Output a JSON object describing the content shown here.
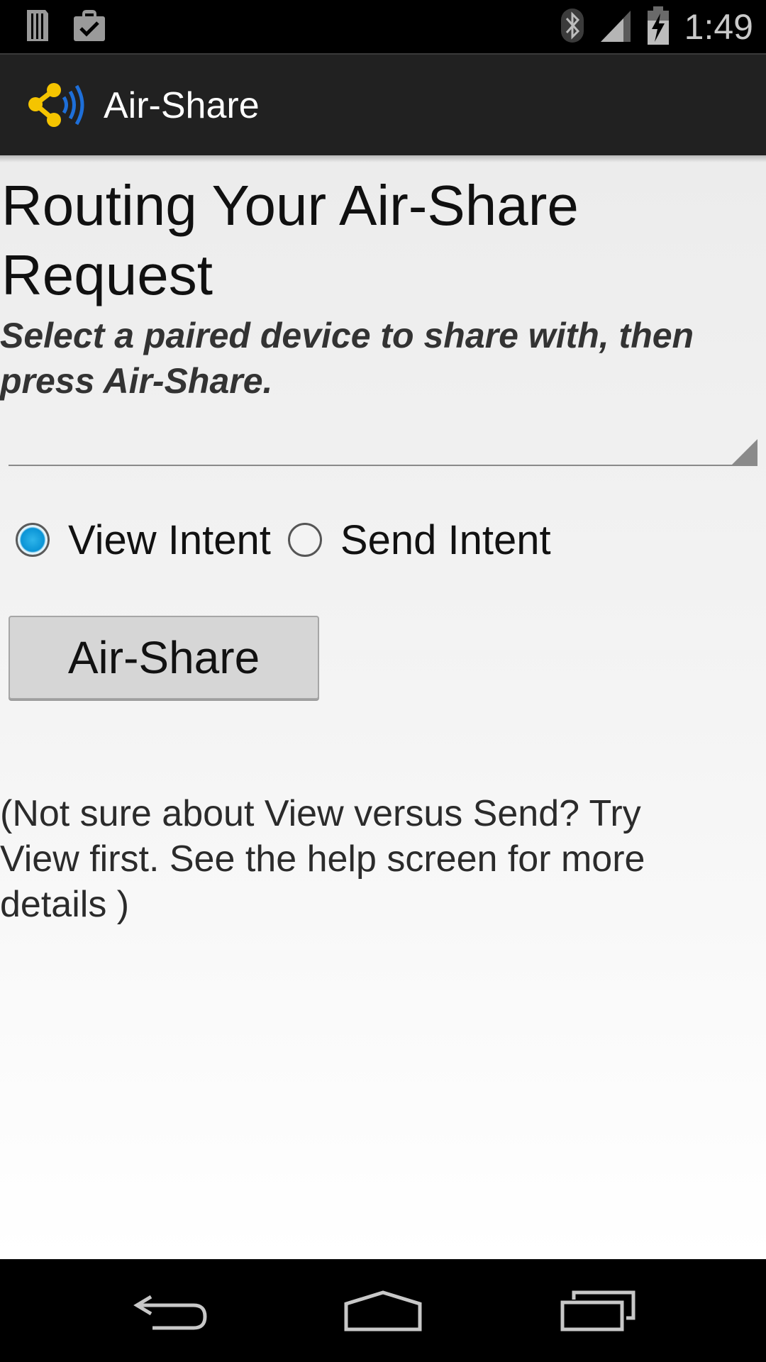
{
  "status_bar": {
    "time": "1:49",
    "icons": [
      "sim-card-icon",
      "briefcase-check-icon",
      "bluetooth-icon",
      "signal-icon",
      "battery-charging-icon"
    ]
  },
  "app_bar": {
    "title": "Air-Share",
    "icon": "air-share-logo-icon",
    "brand_color": "#f5c400",
    "accent_color": "#1e6fd9"
  },
  "main": {
    "title": "Routing Your Air-Share Request",
    "subtitle": "Select a paired device to share with, then press Air-Share.",
    "device_spinner": {
      "selected": ""
    },
    "intent_options": [
      {
        "label": "View Intent",
        "checked": true
      },
      {
        "label": "Send Intent",
        "checked": false
      }
    ],
    "share_button_label": "Air-Share",
    "help_text": "(Not sure about View versus Send? Try View first. See the help screen for more details )"
  },
  "nav_bar": {
    "buttons": [
      "back-icon",
      "home-icon",
      "recent-apps-icon"
    ]
  }
}
